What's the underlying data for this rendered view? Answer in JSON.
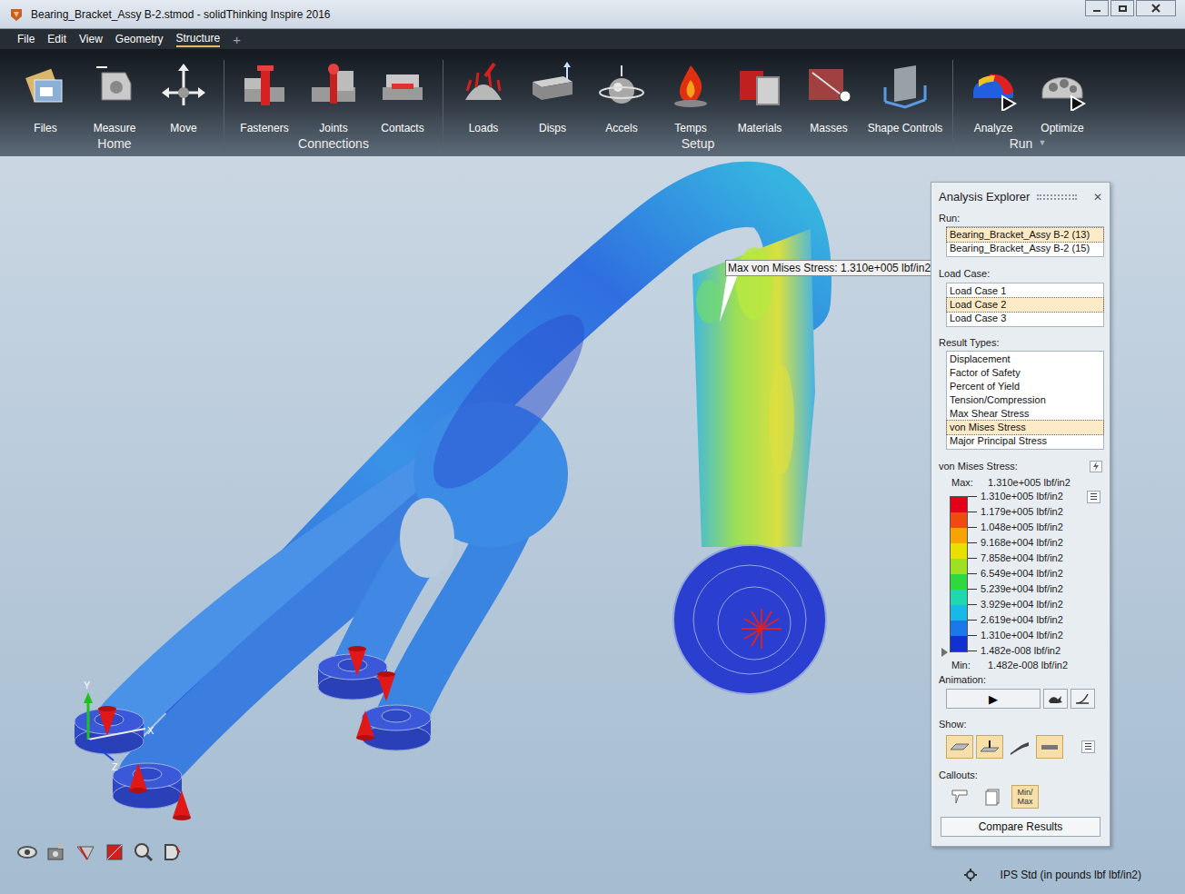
{
  "window": {
    "title": "Bearing_Bracket_Assy B-2.stmod - solidThinking Inspire 2016"
  },
  "menu": {
    "items": [
      {
        "label": "File",
        "selected": false
      },
      {
        "label": "Edit",
        "selected": false
      },
      {
        "label": "View",
        "selected": false
      },
      {
        "label": "Geometry",
        "selected": false
      },
      {
        "label": "Structure",
        "selected": true
      }
    ],
    "add": "+"
  },
  "ribbon": {
    "groups": [
      {
        "label": "Home",
        "dropdown": "",
        "items": [
          "Files",
          "Measure",
          "Move"
        ]
      },
      {
        "label": "Connections",
        "dropdown": "",
        "items": [
          "Fasteners",
          "Joints",
          "Contacts"
        ]
      },
      {
        "label": "Setup",
        "dropdown": "",
        "items": [
          "Loads",
          "Disps",
          "Accels",
          "Temps",
          "Materials",
          "Masses",
          "Shape Controls"
        ]
      },
      {
        "label": "Run",
        "dropdown": "▼",
        "items": [
          "Analyze",
          "Optimize"
        ]
      }
    ]
  },
  "viewport": {
    "tooltip": "Max von Mises Stress: 1.310e+005 lbf/in2",
    "axes": [
      "Y",
      "X",
      "Z"
    ]
  },
  "analysis_explorer": {
    "title": "Analysis Explorer",
    "close": "✕",
    "run_label": "Run:",
    "runs": [
      {
        "label": "Bearing_Bracket_Assy B-2 (13)",
        "selected": true
      },
      {
        "label": "Bearing_Bracket_Assy B-2 (15)",
        "selected": false
      }
    ],
    "load_case_label": "Load Case:",
    "load_cases": [
      {
        "label": "Load Case 1",
        "selected": false
      },
      {
        "label": "Load Case 2",
        "selected": true
      },
      {
        "label": "Load Case 3",
        "selected": false
      }
    ],
    "result_types_label": "Result Types:",
    "result_types": [
      {
        "label": "Displacement",
        "selected": false
      },
      {
        "label": "Factor of Safety",
        "selected": false
      },
      {
        "label": "Percent of Yield",
        "selected": false
      },
      {
        "label": "Tension/Compression",
        "selected": false
      },
      {
        "label": "Max Shear Stress",
        "selected": false
      },
      {
        "label": "von Mises Stress",
        "selected": true
      },
      {
        "label": "Major Principal Stress",
        "selected": false
      }
    ],
    "legend": {
      "title": "von Mises Stress:",
      "max_label": "Max:",
      "max": "1.310e+005 lbf/in2",
      "min_label": "Min:",
      "min": "1.482e-008 lbf/in2",
      "ticks": [
        "1.310e+005 lbf/in2",
        "1.179e+005 lbf/in2",
        "1.048e+005 lbf/in2",
        "9.168e+004 lbf/in2",
        "7.858e+004 lbf/in2",
        "6.549e+004 lbf/in2",
        "5.239e+004 lbf/in2",
        "3.929e+004 lbf/in2",
        "2.619e+004 lbf/in2",
        "1.310e+004 lbf/in2",
        "1.482e-008 lbf/in2"
      ],
      "segments": [
        {
          "color": "#e4001a"
        },
        {
          "color": "#f04a10"
        },
        {
          "color": "#f7a400"
        },
        {
          "color": "#e8e000"
        },
        {
          "color": "#9fe020"
        },
        {
          "color": "#30d840"
        },
        {
          "color": "#20d8b0"
        },
        {
          "color": "#18b8e8"
        },
        {
          "color": "#1a78e8"
        },
        {
          "color": "#1030d0"
        }
      ]
    },
    "animation_label": "Animation:",
    "play": "▶",
    "show_label": "Show:",
    "show_toggles": [
      {
        "selected": true
      },
      {
        "selected": true
      },
      {
        "selected": false
      },
      {
        "selected": true
      }
    ],
    "callouts_label": "Callouts:",
    "callouts": [
      {
        "kind": "icon",
        "lines": [],
        "selected": false
      },
      {
        "kind": "icon",
        "lines": [],
        "selected": false
      },
      {
        "kind": "text",
        "lines": [
          "Min/",
          "Max"
        ],
        "selected": true
      }
    ],
    "compare_button": "Compare Results"
  },
  "status_bar": {
    "units": "IPS Std (in pounds lbf lbf/in2)"
  }
}
